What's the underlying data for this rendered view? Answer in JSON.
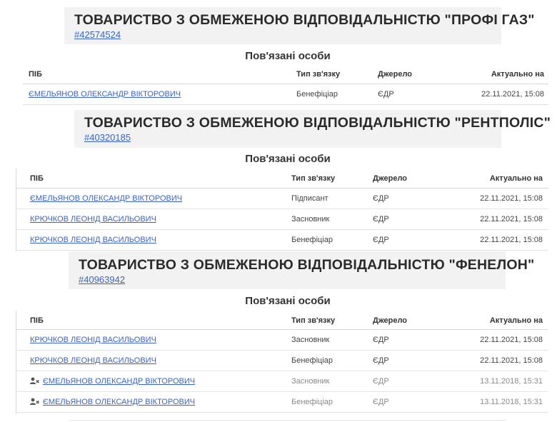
{
  "companies": [
    {
      "title": "ТОВАРИСТВО З ОБМЕЖЕНОЮ ВІДПОВІДАЛЬНІСТЮ \"ПРОФІ ГАЗ\"",
      "code": "#42574524",
      "section_title": "Пов'язані особи",
      "columns": [
        "ПІБ",
        "Тип зв'язку",
        "Джерело",
        "Актуально на"
      ],
      "rows": [
        {
          "name": "ЄМЕЛЬЯНОВ ОЛЕКСАНДР ВІКТОРОВИЧ",
          "type": "Бенефіціар",
          "source": "ЄДР",
          "date": "22.11.2021, 15:08"
        }
      ]
    },
    {
      "title": "ТОВАРИСТВО З ОБМЕЖЕНОЮ ВІДПОВІДАЛЬНІСТЮ \"РЕНТПОЛІС\"",
      "code": "#40320185",
      "section_title": "Пов'язані особи",
      "columns": [
        "ПІБ",
        "Тип зв'язку",
        "Джерело",
        "Актуально на"
      ],
      "rows": [
        {
          "name": "ЄМЕЛЬЯНОВ ОЛЕКСАНДР ВІКТОРОВИЧ",
          "type": "Підписант",
          "source": "ЄДР",
          "date": "22.11.2021, 15:08"
        },
        {
          "name": "КРЮЧКОВ ЛЕОНІД ВАСИЛЬОВИЧ",
          "type": "Засновник",
          "source": "ЄДР",
          "date": "22.11.2021, 15:08"
        },
        {
          "name": "КРЮЧКОВ ЛЕОНІД ВАСИЛЬОВИЧ",
          "type": "Бенефіціар",
          "source": "ЄДР",
          "date": "22.11.2021, 15:08"
        }
      ]
    },
    {
      "title": "ТОВАРИСТВО З ОБМЕЖЕНОЮ ВІДПОВІДАЛЬНІСТЮ \"ФЕНЕЛОН\"",
      "code": "#40963942",
      "section_title": "Пов'язані особи",
      "columns": [
        "ПІБ",
        "Тип зв'язку",
        "Джерело",
        "Актуально на"
      ],
      "rows": [
        {
          "name": "КРЮЧКОВ ЛЕОНІД ВАСИЛЬОВИЧ",
          "type": "Засновник",
          "source": "ЄДР",
          "date": "22.11.2021, 15:08"
        },
        {
          "name": "КРЮЧКОВ ЛЕОНІД ВАСИЛЬОВИЧ",
          "type": "Бенефіціар",
          "source": "ЄДР",
          "date": "22.11.2021, 15:08"
        },
        {
          "name": "ЄМЕЛЬЯНОВ ОЛЕКСАНДР ВІКТОРОВИЧ",
          "type": "Засновник",
          "source": "ЄДР",
          "date": "13.11.2018, 15:31",
          "icon": "user-removed-icon"
        },
        {
          "name": "ЄМЕЛЬЯНОВ ОЛЕКСАНДР ВІКТОРОВИЧ",
          "type": "Бенефіціар",
          "source": "ЄДР",
          "date": "13.11.2018, 15:31",
          "icon": "user-removed-icon"
        }
      ]
    }
  ]
}
